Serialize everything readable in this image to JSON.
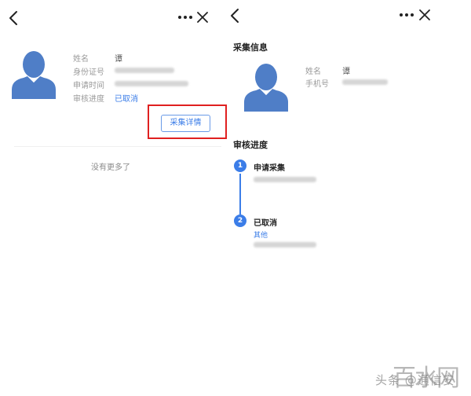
{
  "left_panel": {
    "info": {
      "labels": [
        "姓名",
        "身份证号",
        "申请时间",
        "审核进度"
      ],
      "name_value": "谭",
      "status": "已取消"
    },
    "detail_button_label": "采集详情",
    "no_more_text": "没有更多了"
  },
  "right_panel": {
    "collect_title": "采集信息",
    "info": {
      "labels": [
        "姓名",
        "手机号"
      ],
      "name_value": "谭"
    },
    "progress_title": "审核进度",
    "steps": [
      {
        "number": "1",
        "title": "申请采集",
        "sub": ""
      },
      {
        "number": "2",
        "title": "已取消",
        "sub": "其他"
      }
    ]
  },
  "watermark": {
    "text": "头条 @通信安",
    "logo": "百水网"
  },
  "colors": {
    "accent": "#3b7de8",
    "avatar": "#4f7ec7",
    "highlight": "#e02020"
  },
  "icons": [
    "back-arrow-icon",
    "more-icon",
    "close-icon",
    "avatar-icon"
  ]
}
